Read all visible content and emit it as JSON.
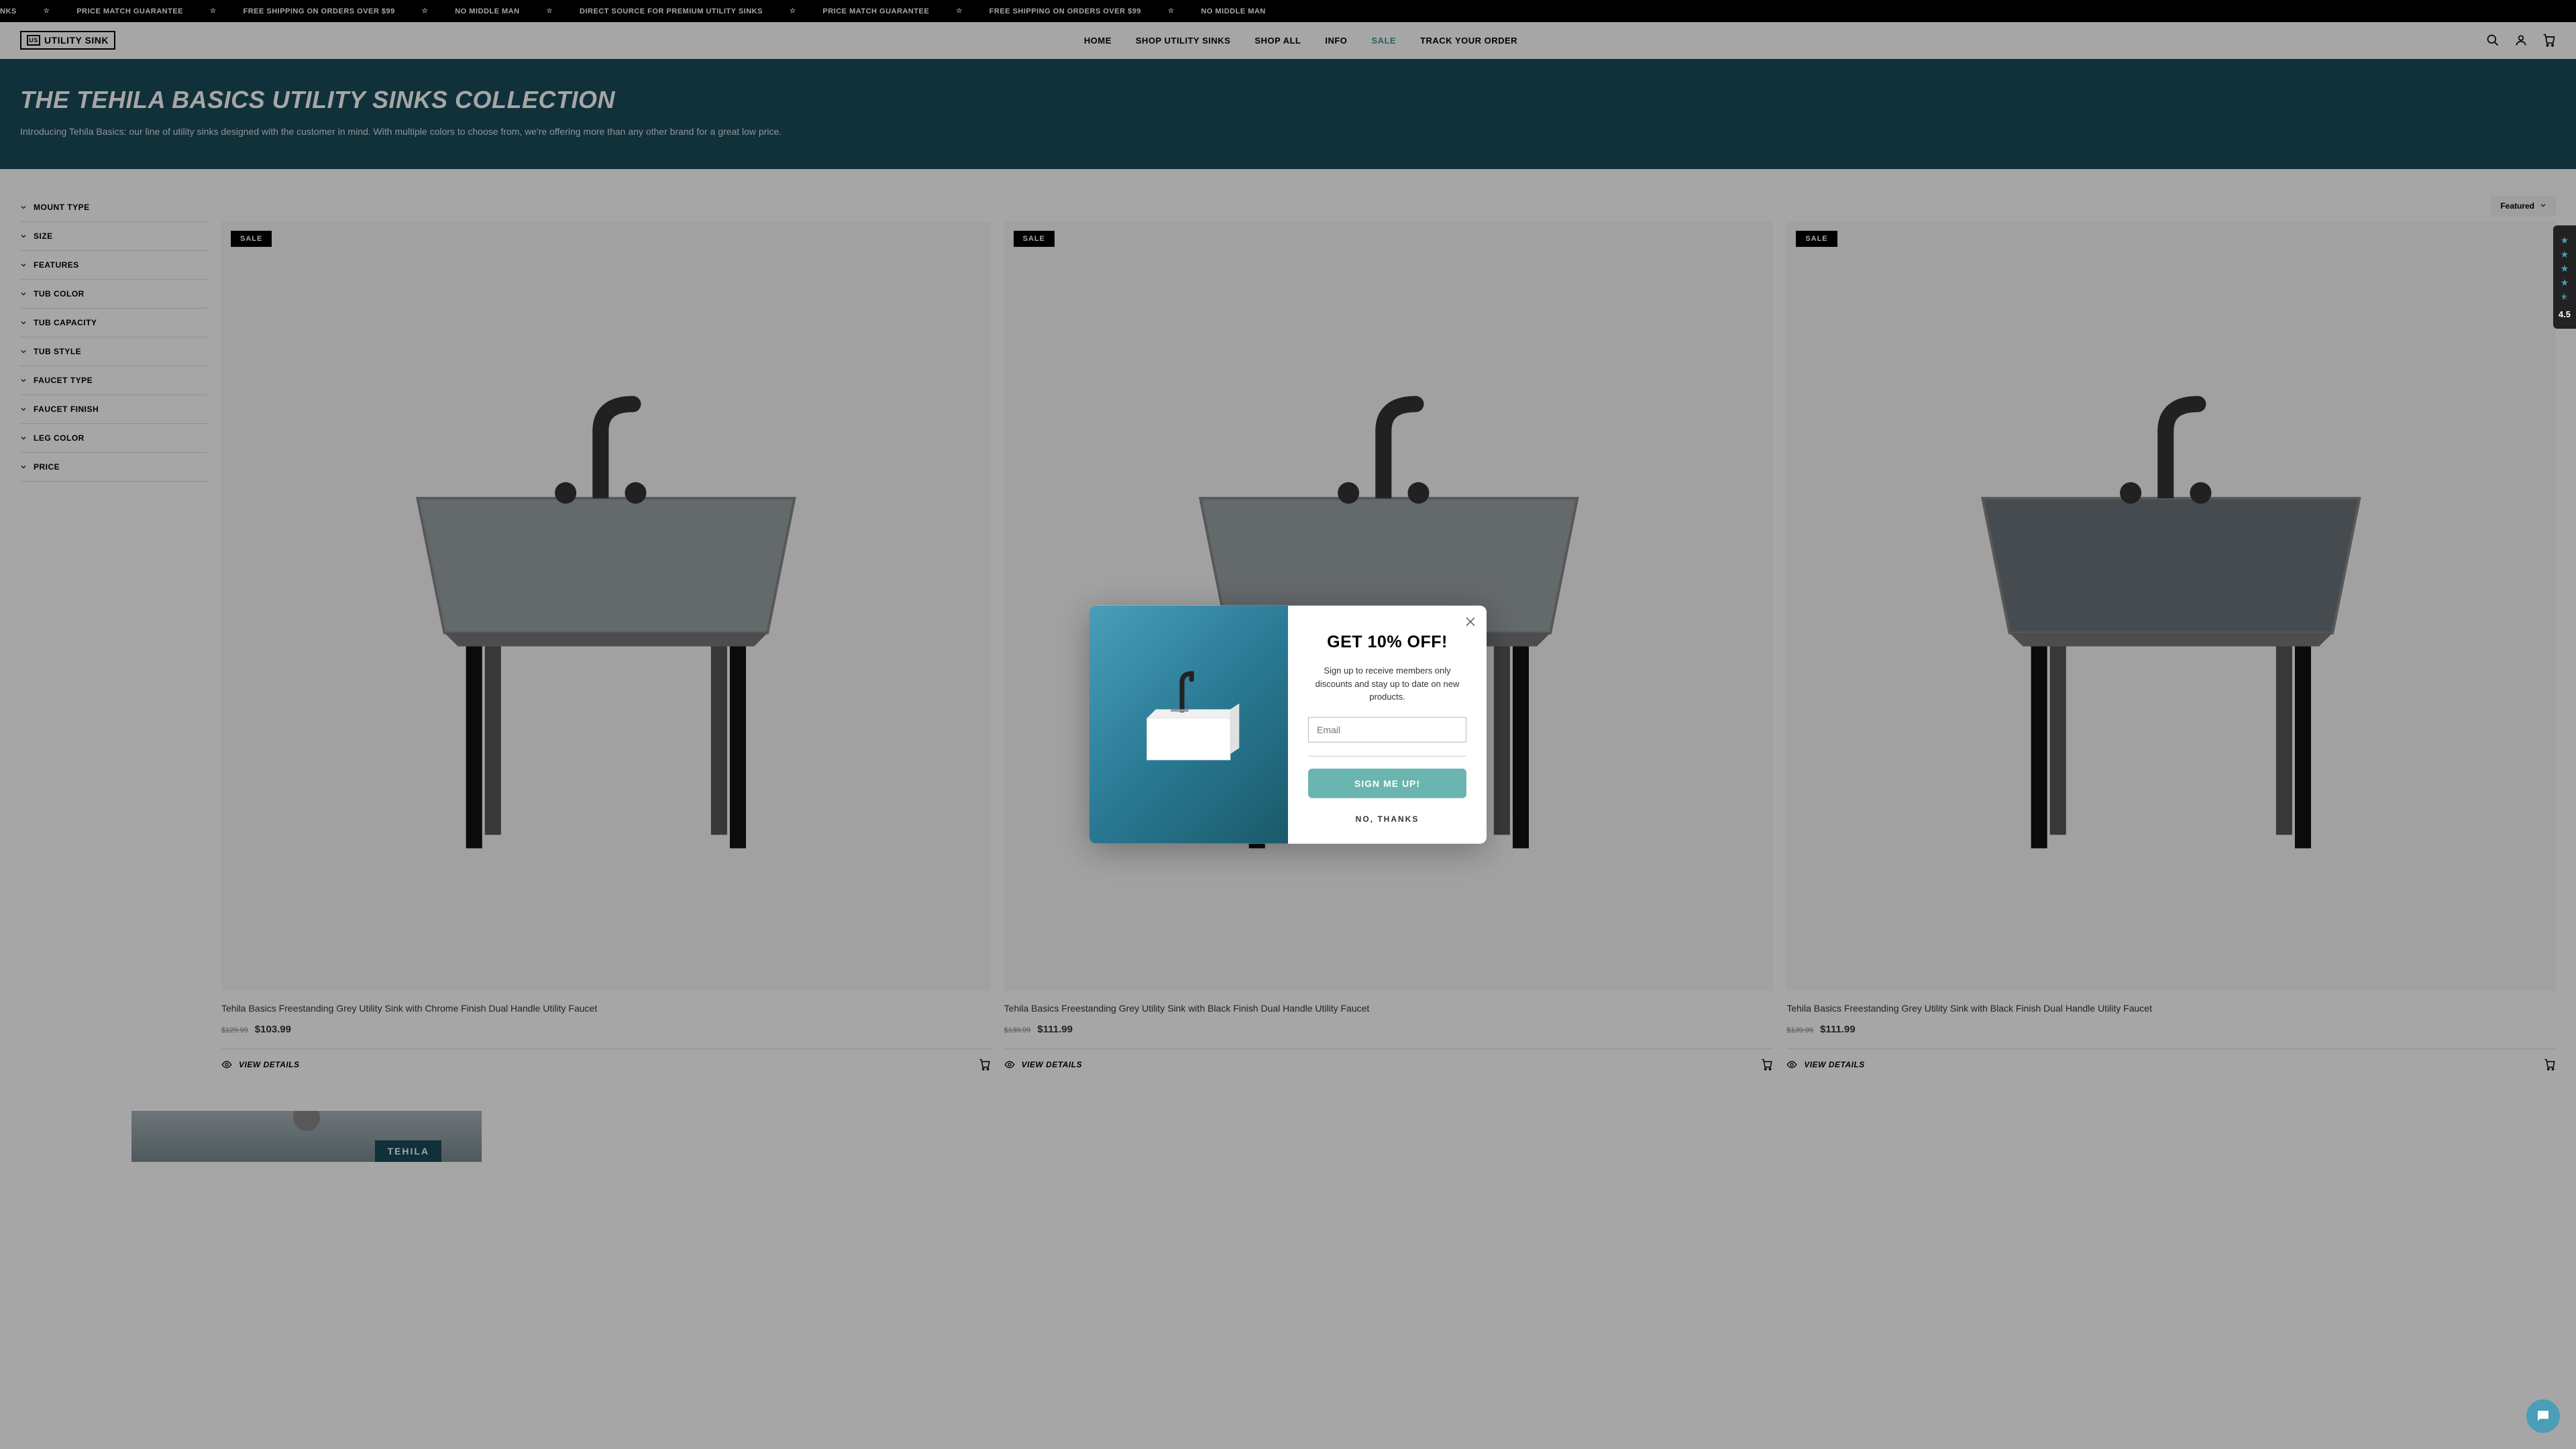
{
  "announcement": {
    "items": [
      "NKS",
      "PRICE MATCH GUARANTEE",
      "FREE SHIPPING ON ORDERS OVER $99",
      "NO MIDDLE MAN",
      "DIRECT SOURCE FOR PREMIUM UTILITY SINKS",
      "PRICE MATCH GUARANTEE",
      "FREE SHIPPING ON ORDERS OVER $99",
      "NO MIDDLE MAN"
    ]
  },
  "logo": {
    "mark": "US",
    "text": "UTILITY SINK"
  },
  "nav": {
    "home": "HOME",
    "shop_utility": "SHOP UTILITY SINKS",
    "shop_all": "SHOP ALL",
    "info": "INFO",
    "sale": "SALE",
    "track": "TRACK YOUR ORDER"
  },
  "hero": {
    "title": "THE TEHILA BASICS UTILITY SINKS COLLECTION",
    "subtitle": "Introducing Tehila Basics: our line of utility sinks designed with the customer in mind. With multiple colors to choose from, we're offering more than any other brand for a great low price."
  },
  "filters": [
    "MOUNT TYPE",
    "SIZE",
    "FEATURES",
    "TUB COLOR",
    "TUB CAPACITY",
    "TUB STYLE",
    "FAUCET TYPE",
    "FAUCET FINISH",
    "LEG COLOR",
    "PRICE"
  ],
  "sort": {
    "label": "Featured"
  },
  "sale_badge": "SALE",
  "view_details": "VIEW DETAILS",
  "products": [
    {
      "title": "Tehila Basics Freestanding Grey Utility Sink with Chrome Finish Dual Handle Utility Faucet",
      "old_price": "$129.99",
      "price": "$103.99",
      "tub_color": "#9aa1a5",
      "leg_color": "#111"
    },
    {
      "title": "Tehila Basics Freestanding Grey Utility Sink with Black Finish Dual Handle Utility Faucet",
      "old_price": "$139.99",
      "price": "$111.99",
      "tub_color": "#9aa1a5",
      "leg_color": "#111"
    },
    {
      "title": "Tehila Basics Freestanding Grey Utility Sink with Black Finish Dual Handle Utility Faucet",
      "old_price": "$139.99",
      "price": "$111.99",
      "tub_color": "#6b7378",
      "leg_color": "#111"
    }
  ],
  "feature_banner": {
    "label": "TEHILA"
  },
  "modal": {
    "title": "GET 10% OFF!",
    "subtitle": "Sign up to receive members only discounts and stay up to date on new products.",
    "email_placeholder": "Email",
    "cta": "SIGN ME UP!",
    "decline": "NO, THANKS"
  },
  "reviews": {
    "score": "4.5"
  },
  "colors": {
    "accent_teal": "#4a9eb8",
    "btn_teal": "#6ab5b0",
    "hero_bg": "#1a4a5a",
    "sale_green": "#469695"
  }
}
